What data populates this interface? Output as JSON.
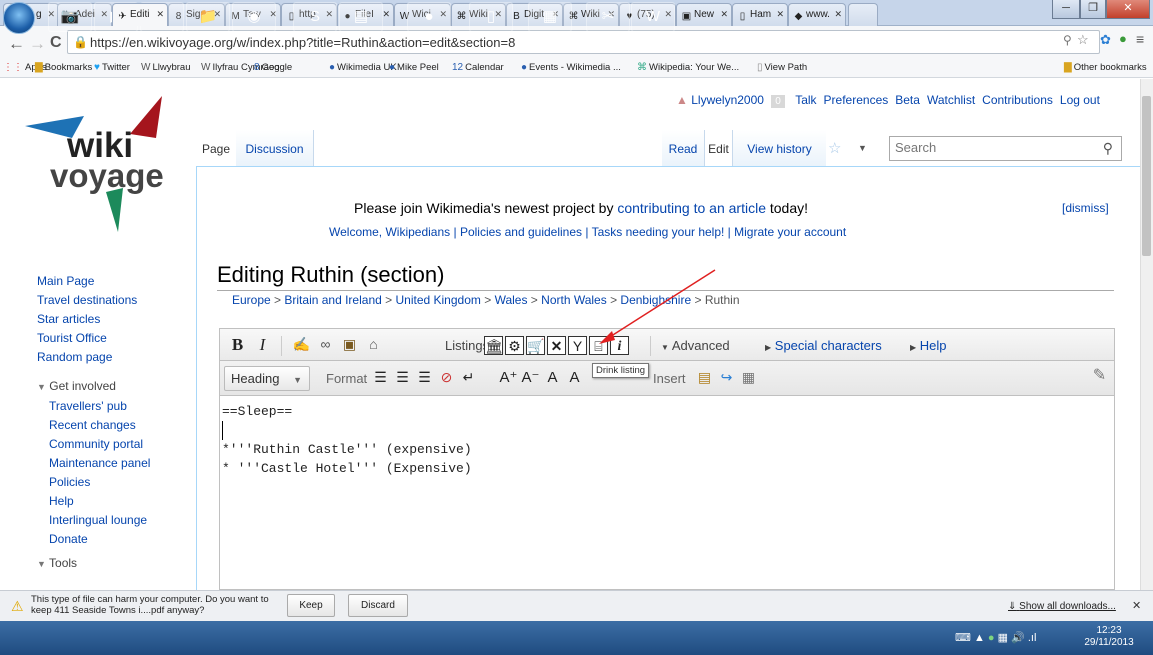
{
  "browser": {
    "tabs": [
      {
        "icon": "W",
        "title": "Yn g"
      },
      {
        "icon": "W",
        "title": "Adei"
      },
      {
        "icon": "✈",
        "title": "Editi"
      },
      {
        "icon": "8",
        "title": "Sign"
      },
      {
        "icon": "M",
        "title": "Taw"
      },
      {
        "icon": "▯",
        "title": "http:"
      },
      {
        "icon": "●",
        "title": "FileI"
      },
      {
        "icon": "W",
        "title": "Wici"
      },
      {
        "icon": "⌘",
        "title": "Wiki"
      },
      {
        "icon": "B",
        "title": "Digit"
      },
      {
        "icon": "⌘",
        "title": "Wiki"
      },
      {
        "icon": "♥",
        "title": "(75)"
      },
      {
        "icon": "▣",
        "title": "New"
      },
      {
        "icon": "▯",
        "title": "Ham"
      },
      {
        "icon": "◆",
        "title": "www."
      }
    ],
    "url": "https://en.wikivoyage.org/w/index.php?title=Ruthin&action=edit&section=8",
    "bookmarks": [
      "Apps",
      "Bookmarks",
      "Twitter",
      "Llwybrau",
      "Ilyfrau Cymraeg",
      "Google",
      "Wikimedia UK",
      "Mike Peel",
      "Calendar",
      "Events - Wikimedia ...",
      "Wikipedia: Your We...",
      "View Path"
    ],
    "other_bookmarks": "Other bookmarks"
  },
  "wiki": {
    "logo_top": "wiki",
    "logo_bottom": "voyage",
    "user": "Llywelyn2000",
    "notif": "0",
    "personal": [
      "Talk",
      "Preferences",
      "Beta",
      "Watchlist",
      "Contributions",
      "Log out"
    ],
    "tabs": {
      "page": "Page",
      "discussion": "Discussion",
      "read": "Read",
      "edit": "Edit",
      "history": "View history"
    },
    "search_placeholder": "Search",
    "notice_pre": "Please join Wikimedia's newest project by ",
    "notice_link": "contributing to an article",
    "notice_post": " today!",
    "notice_links": "Welcome, Wikipedians | Policies and guidelines | Tasks needing your help! | Migrate your account",
    "dismiss": "[dismiss]",
    "title": "Editing Ruthin (section)",
    "breadcrumbs": [
      "Europe",
      "Britain and Ireland",
      "United Kingdom",
      "Wales",
      "North Wales",
      "Denbighshire"
    ],
    "breadcrumb_current": "Ruthin",
    "sidebar_main": [
      "Main Page",
      "Travel destinations",
      "Star articles",
      "Tourist Office",
      "Random page"
    ],
    "get_involved": "Get involved",
    "sidebar_involved": [
      "Travellers' pub",
      "Recent changes",
      "Community portal",
      "Maintenance panel",
      "Policies",
      "Help",
      "Interlingual lounge",
      "Donate"
    ],
    "tools": "Tools"
  },
  "editor": {
    "listings": "Listings",
    "advanced": "Advanced",
    "special": "Special characters",
    "help": "Help",
    "heading": "Heading",
    "format": "Format",
    "insert": "Insert",
    "tooltip": "Drink listing",
    "line1": "==Sleep==",
    "line2": "",
    "line3": "*'''Ruthin Castle''' (expensive)",
    "line4": "* '''Castle Hotel''' (Expensive)"
  },
  "downloads": {
    "warning": "This type of file can harm your computer. Do you want to keep 411 Seaside Towns i....pdf anyway?",
    "keep": "Keep",
    "discard": "Discard",
    "show_all": "Show all downloads..."
  },
  "taskbar": {
    "time": "12:23",
    "date": "29/11/2013"
  }
}
